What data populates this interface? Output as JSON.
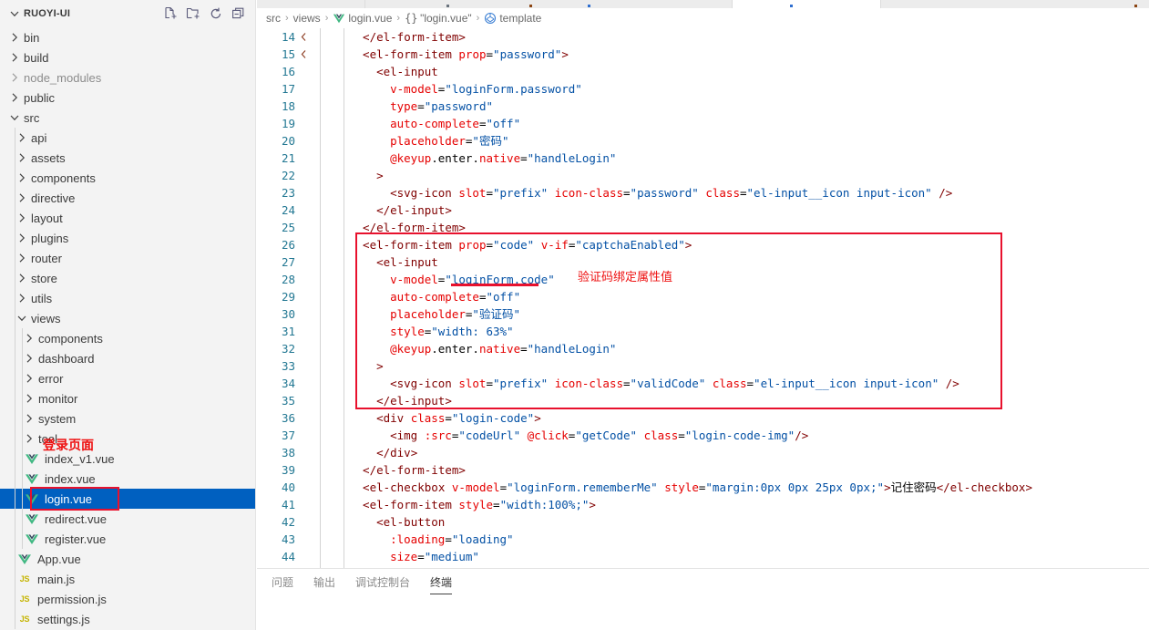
{
  "sidebar": {
    "title": "RUOYI-UI",
    "actions": [
      {
        "name": "new-file-icon",
        "label": "New File"
      },
      {
        "name": "new-folder-icon",
        "label": "New Folder"
      },
      {
        "name": "refresh-icon",
        "label": "Refresh Explorer"
      },
      {
        "name": "collapse-all-icon",
        "label": "Collapse Folders in Explorer"
      }
    ],
    "items": [
      {
        "label": "bin",
        "depth": 1,
        "kind": "folder",
        "expanded": false,
        "dim": false
      },
      {
        "label": "build",
        "depth": 1,
        "kind": "folder",
        "expanded": false,
        "dim": false
      },
      {
        "label": "node_modules",
        "depth": 1,
        "kind": "folder",
        "expanded": false,
        "dim": true
      },
      {
        "label": "public",
        "depth": 1,
        "kind": "folder",
        "expanded": false,
        "dim": false
      },
      {
        "label": "src",
        "depth": 1,
        "kind": "folder",
        "expanded": true,
        "dim": false
      },
      {
        "label": "api",
        "depth": 2,
        "kind": "folder",
        "expanded": false,
        "dim": false
      },
      {
        "label": "assets",
        "depth": 2,
        "kind": "folder",
        "expanded": false,
        "dim": false
      },
      {
        "label": "components",
        "depth": 2,
        "kind": "folder",
        "expanded": false,
        "dim": false
      },
      {
        "label": "directive",
        "depth": 2,
        "kind": "folder",
        "expanded": false,
        "dim": false
      },
      {
        "label": "layout",
        "depth": 2,
        "kind": "folder",
        "expanded": false,
        "dim": false
      },
      {
        "label": "plugins",
        "depth": 2,
        "kind": "folder",
        "expanded": false,
        "dim": false
      },
      {
        "label": "router",
        "depth": 2,
        "kind": "folder",
        "expanded": false,
        "dim": false
      },
      {
        "label": "store",
        "depth": 2,
        "kind": "folder",
        "expanded": false,
        "dim": false
      },
      {
        "label": "utils",
        "depth": 2,
        "kind": "folder",
        "expanded": false,
        "dim": false
      },
      {
        "label": "views",
        "depth": 2,
        "kind": "folder",
        "expanded": true,
        "dim": false
      },
      {
        "label": "components",
        "depth": 3,
        "kind": "folder",
        "expanded": false,
        "dim": false
      },
      {
        "label": "dashboard",
        "depth": 3,
        "kind": "folder",
        "expanded": false,
        "dim": false
      },
      {
        "label": "error",
        "depth": 3,
        "kind": "folder",
        "expanded": false,
        "dim": false
      },
      {
        "label": "monitor",
        "depth": 3,
        "kind": "folder",
        "expanded": false,
        "dim": false
      },
      {
        "label": "system",
        "depth": 3,
        "kind": "folder",
        "expanded": false,
        "dim": false
      },
      {
        "label": "tool",
        "depth": 3,
        "kind": "folder",
        "expanded": false,
        "dim": false
      },
      {
        "label": "index_v1.vue",
        "depth": 3,
        "kind": "vue",
        "expanded": false,
        "dim": false
      },
      {
        "label": "index.vue",
        "depth": 3,
        "kind": "vue",
        "expanded": false,
        "dim": false
      },
      {
        "label": "login.vue",
        "depth": 3,
        "kind": "vue",
        "expanded": false,
        "dim": false,
        "selected": true
      },
      {
        "label": "redirect.vue",
        "depth": 3,
        "kind": "vue",
        "expanded": false,
        "dim": false
      },
      {
        "label": "register.vue",
        "depth": 3,
        "kind": "vue",
        "expanded": false,
        "dim": false
      },
      {
        "label": "App.vue",
        "depth": 2,
        "kind": "vue",
        "expanded": false,
        "dim": false
      },
      {
        "label": "main.js",
        "depth": 2,
        "kind": "js",
        "expanded": false,
        "dim": false
      },
      {
        "label": "permission.js",
        "depth": 2,
        "kind": "js",
        "expanded": false,
        "dim": false
      },
      {
        "label": "settings.js",
        "depth": 2,
        "kind": "js",
        "expanded": false,
        "dim": false
      }
    ]
  },
  "breadcrumb": [
    {
      "label": "src",
      "icon": null
    },
    {
      "label": "views",
      "icon": null
    },
    {
      "label": "login.vue",
      "icon": "vue-icon"
    },
    {
      "label": "\"login.vue\"",
      "icon": "braces-icon"
    },
    {
      "label": "template",
      "icon": "symbol-namespace-icon"
    }
  ],
  "editor": {
    "first_line": 14,
    "lines": [
      {
        "n": 14,
        "indent": 3,
        "tokens": [
          {
            "t": "tag",
            "v": "</el-form-item>"
          }
        ]
      },
      {
        "n": 15,
        "indent": 3,
        "tokens": [
          {
            "t": "tag",
            "v": "<el-form-item "
          },
          {
            "t": "attr",
            "v": "prop"
          },
          {
            "t": "punc",
            "v": "="
          },
          {
            "t": "str",
            "v": "\"password\""
          },
          {
            "t": "tag",
            "v": ">"
          }
        ]
      },
      {
        "n": 16,
        "indent": 4,
        "tokens": [
          {
            "t": "tag",
            "v": "<el-input"
          }
        ]
      },
      {
        "n": 17,
        "indent": 5,
        "tokens": [
          {
            "t": "attr",
            "v": "v-model"
          },
          {
            "t": "punc",
            "v": "="
          },
          {
            "t": "str",
            "v": "\"loginForm.password\""
          }
        ]
      },
      {
        "n": 18,
        "indent": 5,
        "tokens": [
          {
            "t": "attr",
            "v": "type"
          },
          {
            "t": "punc",
            "v": "="
          },
          {
            "t": "str",
            "v": "\"password\""
          }
        ]
      },
      {
        "n": 19,
        "indent": 5,
        "tokens": [
          {
            "t": "attr",
            "v": "auto-complete"
          },
          {
            "t": "punc",
            "v": "="
          },
          {
            "t": "str",
            "v": "\"off\""
          }
        ]
      },
      {
        "n": 20,
        "indent": 5,
        "tokens": [
          {
            "t": "attr",
            "v": "placeholder"
          },
          {
            "t": "punc",
            "v": "="
          },
          {
            "t": "str",
            "v": "\"密码\""
          }
        ]
      },
      {
        "n": 21,
        "indent": 5,
        "tokens": [
          {
            "t": "attr",
            "v": "@keyup"
          },
          {
            "t": "punc",
            "v": ".enter."
          },
          {
            "t": "attr",
            "v": "native"
          },
          {
            "t": "punc",
            "v": "="
          },
          {
            "t": "str",
            "v": "\"handleLogin\""
          }
        ]
      },
      {
        "n": 22,
        "indent": 4,
        "tokens": [
          {
            "t": "tag",
            "v": ">"
          }
        ]
      },
      {
        "n": 23,
        "indent": 5,
        "tokens": [
          {
            "t": "tag",
            "v": "<svg-icon "
          },
          {
            "t": "attr",
            "v": "slot"
          },
          {
            "t": "punc",
            "v": "="
          },
          {
            "t": "str",
            "v": "\"prefix\""
          },
          {
            "t": "punc",
            "v": " "
          },
          {
            "t": "attr",
            "v": "icon-class"
          },
          {
            "t": "punc",
            "v": "="
          },
          {
            "t": "str",
            "v": "\"password\""
          },
          {
            "t": "punc",
            "v": " "
          },
          {
            "t": "attr",
            "v": "class"
          },
          {
            "t": "punc",
            "v": "="
          },
          {
            "t": "str",
            "v": "\"el-input__icon input-icon\""
          },
          {
            "t": "tag",
            "v": " />"
          }
        ]
      },
      {
        "n": 24,
        "indent": 4,
        "tokens": [
          {
            "t": "tag",
            "v": "</el-input>"
          }
        ]
      },
      {
        "n": 25,
        "indent": 3,
        "tokens": [
          {
            "t": "tag",
            "v": "</el-form-item>"
          }
        ]
      },
      {
        "n": 26,
        "indent": 3,
        "tokens": [
          {
            "t": "tag",
            "v": "<el-form-item "
          },
          {
            "t": "attr",
            "v": "prop"
          },
          {
            "t": "punc",
            "v": "="
          },
          {
            "t": "str",
            "v": "\"code\""
          },
          {
            "t": "punc",
            "v": " "
          },
          {
            "t": "attr",
            "v": "v-if"
          },
          {
            "t": "punc",
            "v": "="
          },
          {
            "t": "str",
            "v": "\"captchaEnabled\""
          },
          {
            "t": "tag",
            "v": ">"
          }
        ]
      },
      {
        "n": 27,
        "indent": 4,
        "tokens": [
          {
            "t": "tag",
            "v": "<el-input"
          }
        ]
      },
      {
        "n": 28,
        "indent": 5,
        "tokens": [
          {
            "t": "attr",
            "v": "v-model"
          },
          {
            "t": "punc",
            "v": "="
          },
          {
            "t": "str",
            "v": "\"loginForm.code\""
          }
        ]
      },
      {
        "n": 29,
        "indent": 5,
        "tokens": [
          {
            "t": "attr",
            "v": "auto-complete"
          },
          {
            "t": "punc",
            "v": "="
          },
          {
            "t": "str",
            "v": "\"off\""
          }
        ]
      },
      {
        "n": 30,
        "indent": 5,
        "tokens": [
          {
            "t": "attr",
            "v": "placeholder"
          },
          {
            "t": "punc",
            "v": "="
          },
          {
            "t": "str",
            "v": "\"验证码\""
          }
        ]
      },
      {
        "n": 31,
        "indent": 5,
        "tokens": [
          {
            "t": "attr",
            "v": "style"
          },
          {
            "t": "punc",
            "v": "="
          },
          {
            "t": "str",
            "v": "\"width: 63%\""
          }
        ]
      },
      {
        "n": 32,
        "indent": 5,
        "tokens": [
          {
            "t": "attr",
            "v": "@keyup"
          },
          {
            "t": "punc",
            "v": ".enter."
          },
          {
            "t": "attr",
            "v": "native"
          },
          {
            "t": "punc",
            "v": "="
          },
          {
            "t": "str",
            "v": "\"handleLogin\""
          }
        ]
      },
      {
        "n": 33,
        "indent": 4,
        "tokens": [
          {
            "t": "tag",
            "v": ">"
          }
        ]
      },
      {
        "n": 34,
        "indent": 5,
        "tokens": [
          {
            "t": "tag",
            "v": "<svg-icon "
          },
          {
            "t": "attr",
            "v": "slot"
          },
          {
            "t": "punc",
            "v": "="
          },
          {
            "t": "str",
            "v": "\"prefix\""
          },
          {
            "t": "punc",
            "v": " "
          },
          {
            "t": "attr",
            "v": "icon-class"
          },
          {
            "t": "punc",
            "v": "="
          },
          {
            "t": "str",
            "v": "\"validCode\""
          },
          {
            "t": "punc",
            "v": " "
          },
          {
            "t": "attr",
            "v": "class"
          },
          {
            "t": "punc",
            "v": "="
          },
          {
            "t": "str",
            "v": "\"el-input__icon input-icon\""
          },
          {
            "t": "tag",
            "v": " />"
          }
        ]
      },
      {
        "n": 35,
        "indent": 4,
        "tokens": [
          {
            "t": "tag",
            "v": "</el-input>"
          }
        ]
      },
      {
        "n": 36,
        "indent": 4,
        "tokens": [
          {
            "t": "tag",
            "v": "<div "
          },
          {
            "t": "attr",
            "v": "class"
          },
          {
            "t": "punc",
            "v": "="
          },
          {
            "t": "str",
            "v": "\"login-code\""
          },
          {
            "t": "tag",
            "v": ">"
          }
        ]
      },
      {
        "n": 37,
        "indent": 5,
        "tokens": [
          {
            "t": "tag",
            "v": "<img "
          },
          {
            "t": "attr",
            "v": ":src"
          },
          {
            "t": "punc",
            "v": "="
          },
          {
            "t": "str",
            "v": "\"codeUrl\""
          },
          {
            "t": "punc",
            "v": " "
          },
          {
            "t": "attr",
            "v": "@click"
          },
          {
            "t": "punc",
            "v": "="
          },
          {
            "t": "str",
            "v": "\"getCode\""
          },
          {
            "t": "punc",
            "v": " "
          },
          {
            "t": "attr",
            "v": "class"
          },
          {
            "t": "punc",
            "v": "="
          },
          {
            "t": "str",
            "v": "\"login-code-img\""
          },
          {
            "t": "tag",
            "v": "/>"
          }
        ]
      },
      {
        "n": 38,
        "indent": 4,
        "tokens": [
          {
            "t": "tag",
            "v": "</div>"
          }
        ]
      },
      {
        "n": 39,
        "indent": 3,
        "tokens": [
          {
            "t": "tag",
            "v": "</el-form-item>"
          }
        ]
      },
      {
        "n": 40,
        "indent": 3,
        "tokens": [
          {
            "t": "tag",
            "v": "<el-checkbox "
          },
          {
            "t": "attr",
            "v": "v-model"
          },
          {
            "t": "punc",
            "v": "="
          },
          {
            "t": "str",
            "v": "\"loginForm.rememberMe\""
          },
          {
            "t": "punc",
            "v": " "
          },
          {
            "t": "attr",
            "v": "style"
          },
          {
            "t": "punc",
            "v": "="
          },
          {
            "t": "str",
            "v": "\"margin:0px 0px 25px 0px;\""
          },
          {
            "t": "tag",
            "v": ">"
          },
          {
            "t": "txt",
            "v": "记住密码"
          },
          {
            "t": "tag",
            "v": "</el-checkbox>"
          }
        ]
      },
      {
        "n": 41,
        "indent": 3,
        "tokens": [
          {
            "t": "tag",
            "v": "<el-form-item "
          },
          {
            "t": "attr",
            "v": "style"
          },
          {
            "t": "punc",
            "v": "="
          },
          {
            "t": "str",
            "v": "\"width:100%;\""
          },
          {
            "t": "tag",
            "v": ">"
          }
        ]
      },
      {
        "n": 42,
        "indent": 4,
        "tokens": [
          {
            "t": "tag",
            "v": "<el-button"
          }
        ]
      },
      {
        "n": 43,
        "indent": 5,
        "tokens": [
          {
            "t": "attr",
            "v": ":loading"
          },
          {
            "t": "punc",
            "v": "="
          },
          {
            "t": "str",
            "v": "\"loading\""
          }
        ]
      },
      {
        "n": 44,
        "indent": 5,
        "tokens": [
          {
            "t": "attr",
            "v": "size"
          },
          {
            "t": "punc",
            "v": "="
          },
          {
            "t": "str",
            "v": "\"medium\""
          }
        ]
      }
    ]
  },
  "annotations": {
    "code_note": "验证码绑定属性值",
    "sidebar_note": "登录页面",
    "highlight_color": "#e8112d"
  },
  "panel": {
    "tabs": [
      {
        "label": "问题",
        "active": false
      },
      {
        "label": "输出",
        "active": false
      },
      {
        "label": "调试控制台",
        "active": false
      },
      {
        "label": "终端",
        "active": true
      }
    ]
  }
}
